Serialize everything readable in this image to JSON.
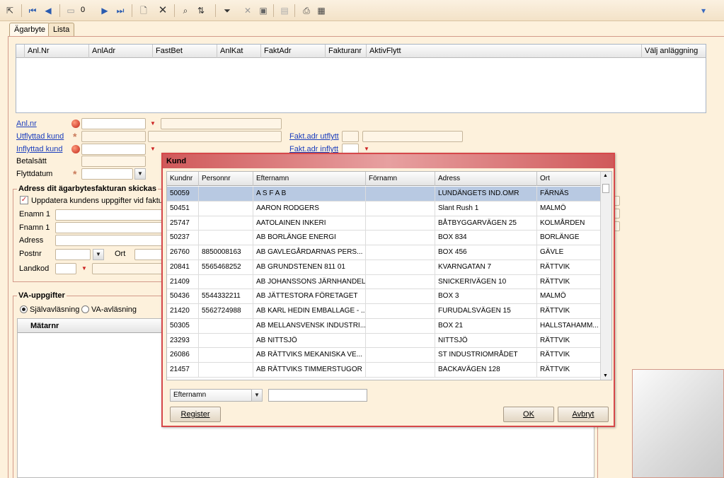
{
  "toolbar": {
    "record_count": "0"
  },
  "tabs": [
    {
      "label": "Ägarbyte"
    },
    {
      "label": "Lista"
    }
  ],
  "top_grid": {
    "columns": [
      "Anl.Nr",
      "AnlAdr",
      "FastBet",
      "AnlKat",
      "FaktAdr",
      "Fakturanr",
      "AktivFlytt",
      "Välj anläggning"
    ]
  },
  "form": {
    "anlnr_label": "Anl.nr",
    "utflyttad_label": "Utflyttad kund",
    "inflyttad_label": "Inflyttad kund",
    "betalsatt_label": "Betalsätt",
    "flyttdatum_label": "Flyttdatum",
    "fakt_utflytt_label": "Fakt.adr utflytt",
    "fakt_inflytt_label": "Fakt.adr inflytt"
  },
  "address_group": {
    "title": "Adress dit ägarbytesfakturan skickas",
    "checkbox_label": "Uppdatera kundens uppgifter vid fakture",
    "enamn_label": "Enamn 1",
    "fnamn_label": "Fnamn 1",
    "adress_label": "Adress",
    "postnr_label": "Postnr",
    "ort_label": "Ort",
    "landkod_label": "Landkod"
  },
  "va_group": {
    "title": "VA-uppgifter",
    "radio1": "Självavläsning",
    "radio2": "VA-avläsning",
    "column": "Mätarnr"
  },
  "dialog": {
    "title": "Kund",
    "columns": [
      "Kundnr",
      "Personnr",
      "Efternamn",
      "Förnamn",
      "Adress",
      "Ort"
    ],
    "rows": [
      [
        "50059",
        "",
        "A S F A B",
        "",
        "LUNDÄNGETS IND.OMR",
        "FÄRNÄS"
      ],
      [
        "50451",
        "",
        "AARON RODGERS",
        "",
        "Slant Rush 1",
        "MALMÖ"
      ],
      [
        "25747",
        "",
        "AATOLAINEN INKERI",
        "",
        "BÅTBYGGARVÄGEN 25",
        "KOLMÅRDEN"
      ],
      [
        "50237",
        "",
        "AB BORLÄNGE ENERGI",
        "",
        "BOX 834",
        "BORLÄNGE"
      ],
      [
        "26760",
        "8850008163",
        "AB GAVLEGÅRDARNAS PERS...",
        "",
        "BOX 456",
        "GÄVLE"
      ],
      [
        "20841",
        "5565468252",
        "AB GRUNDSTENEN 811 01",
        "",
        "KVARNGATAN 7",
        "RÄTTVIK"
      ],
      [
        "21409",
        "",
        "AB JOHANSSONS JÄRNHANDEL",
        "",
        "SNICKERIVÄGEN 10",
        "RÄTTVIK"
      ],
      [
        "50436",
        "5544332211",
        "AB JÄTTESTORA FÖRETAGET",
        "",
        "BOX 3",
        "MALMÖ"
      ],
      [
        "21420",
        "5562724988",
        "AB KARL HEDIN EMBALLAGE - ...",
        "",
        "FURUDALSVÄGEN 15",
        "RÄTTVIK"
      ],
      [
        "50305",
        "",
        "AB MELLANSVENSK INDUSTRI...",
        "",
        "BOX 21",
        "HALLSTAHAMM..."
      ],
      [
        "23293",
        "",
        "AB NITTSJÖ",
        "",
        "NITTSJÖ",
        "RÄTTVIK"
      ],
      [
        "26086",
        "",
        "AB RÄTTVIKS MEKANISKA VE...",
        "",
        "ST INDUSTRIOMRÅDET",
        "RÄTTVIK"
      ],
      [
        "21457",
        "",
        "AB RÄTTVIKS TIMMERSTUGOR",
        "",
        "BACKAVÄGEN 128",
        "RÄTTVIK"
      ]
    ],
    "search_field": "Efternamn",
    "search_value": "",
    "register_button": "Register",
    "ok_button": "OK",
    "cancel_button": "Avbryt"
  }
}
